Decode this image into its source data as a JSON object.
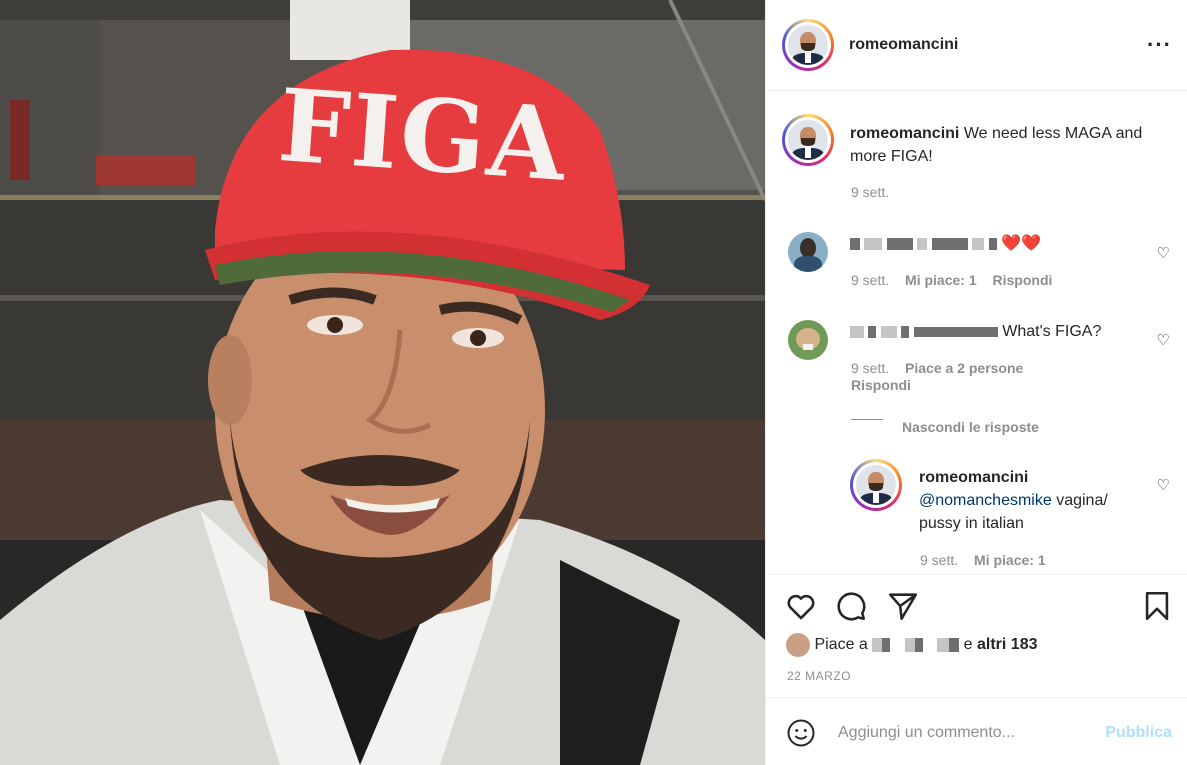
{
  "post": {
    "username": "romeomancini",
    "more_icon": "more-horizontal-icon",
    "cap_text": "FIGA"
  },
  "caption": {
    "username": "romeomancini",
    "text": "We need less MAGA and more FIGA!",
    "time": "9 sett."
  },
  "comments": [
    {
      "emoji": "❤️❤️",
      "time": "9 sett.",
      "likes": "Mi piace: 1",
      "reply": "Rispondi"
    },
    {
      "text": "What's FIGA?",
      "time": "9 sett.",
      "likes": "Piace a 2 persone",
      "reply": "Rispondi",
      "hide_replies": "Nascondi le risposte"
    }
  ],
  "reply": {
    "username": "romeomancini",
    "mention": "@nomanchesmike",
    "text": " vagina/ pussy in italian",
    "time": "9 sett.",
    "likes": "Mi piace: 1"
  },
  "footer": {
    "likes_prefix": "Piace a",
    "likes_suffix": "e",
    "likes_others": "altri 183",
    "date": "22 MARZO",
    "comment_placeholder": "Aggiungi un commento...",
    "post_label": "Pubblica"
  },
  "colors": {
    "cap_red": "#e63b3f",
    "link": "#00376b",
    "post_disabled": "#b2dffc",
    "meta_gray": "#8e8e8e"
  }
}
